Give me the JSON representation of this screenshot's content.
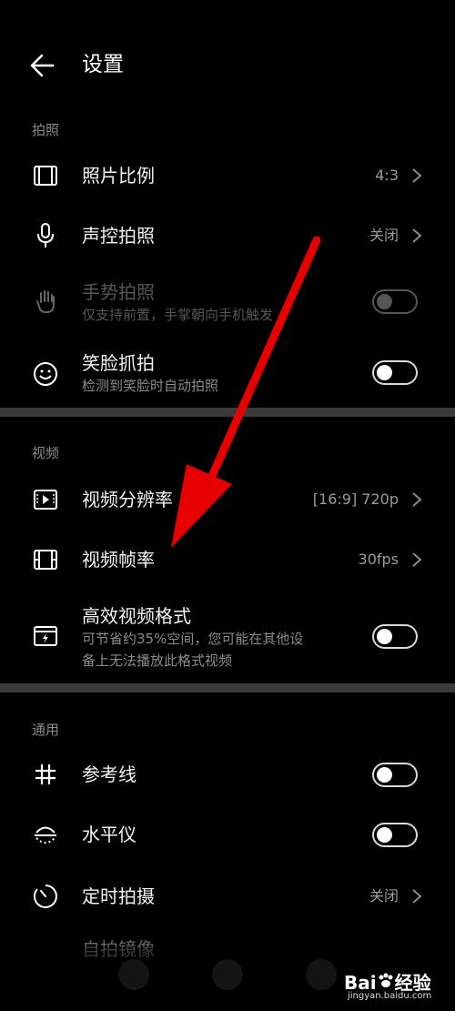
{
  "header": {
    "title": "设置"
  },
  "sections": {
    "photo": {
      "label": "拍照"
    },
    "video": {
      "label": "视频"
    },
    "general": {
      "label": "通用"
    }
  },
  "rows": {
    "aspect": {
      "title": "照片比例",
      "value": "4:3"
    },
    "voice": {
      "title": "声控拍照",
      "value": "关闭"
    },
    "gesture": {
      "title": "手势拍照",
      "subtitle": "仅支持前置，手掌朝向手机触发",
      "enabled": false,
      "on": false
    },
    "smile": {
      "title": "笑脸抓拍",
      "subtitle": "检测到笑脸时自动拍照",
      "on": false
    },
    "resolution": {
      "title": "视频分辨率",
      "value": "[16:9] 720p"
    },
    "framerate": {
      "title": "视频帧率",
      "value": "30fps"
    },
    "efficient": {
      "title": "高效视频格式",
      "subtitle_line1": "可节省约35%空间，您可能在其他设",
      "subtitle_line2": "备上无法播放此格式视频",
      "on": false
    },
    "grid": {
      "title": "参考线",
      "on": false
    },
    "level": {
      "title": "水平仪",
      "on": false
    },
    "timer": {
      "title": "定时拍摄",
      "value": "关闭"
    },
    "mirror": {
      "title": "自拍镜像"
    }
  },
  "watermark": {
    "brand": "Bai",
    "brand2": "经验",
    "url": "jingyan.baidu.com"
  },
  "colors": {
    "background": "#000000",
    "divider": "#3a3a3a",
    "annotation_arrow": "#e60000"
  }
}
